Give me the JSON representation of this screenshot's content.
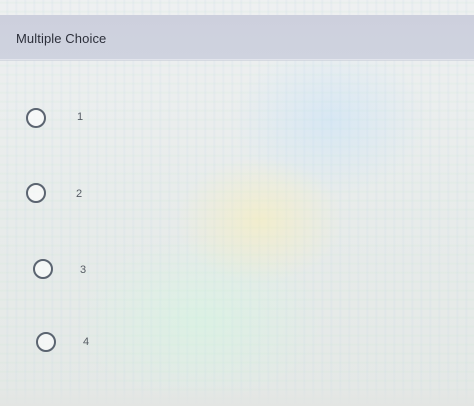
{
  "question": {
    "type_label": "Multiple Choice"
  },
  "options": [
    {
      "label": "1"
    },
    {
      "label": "2"
    },
    {
      "label": "3"
    },
    {
      "label": "4"
    }
  ],
  "colors": {
    "header_bg": "#cfd3df",
    "radio_border": "#5b6470",
    "text": "#555b63"
  }
}
